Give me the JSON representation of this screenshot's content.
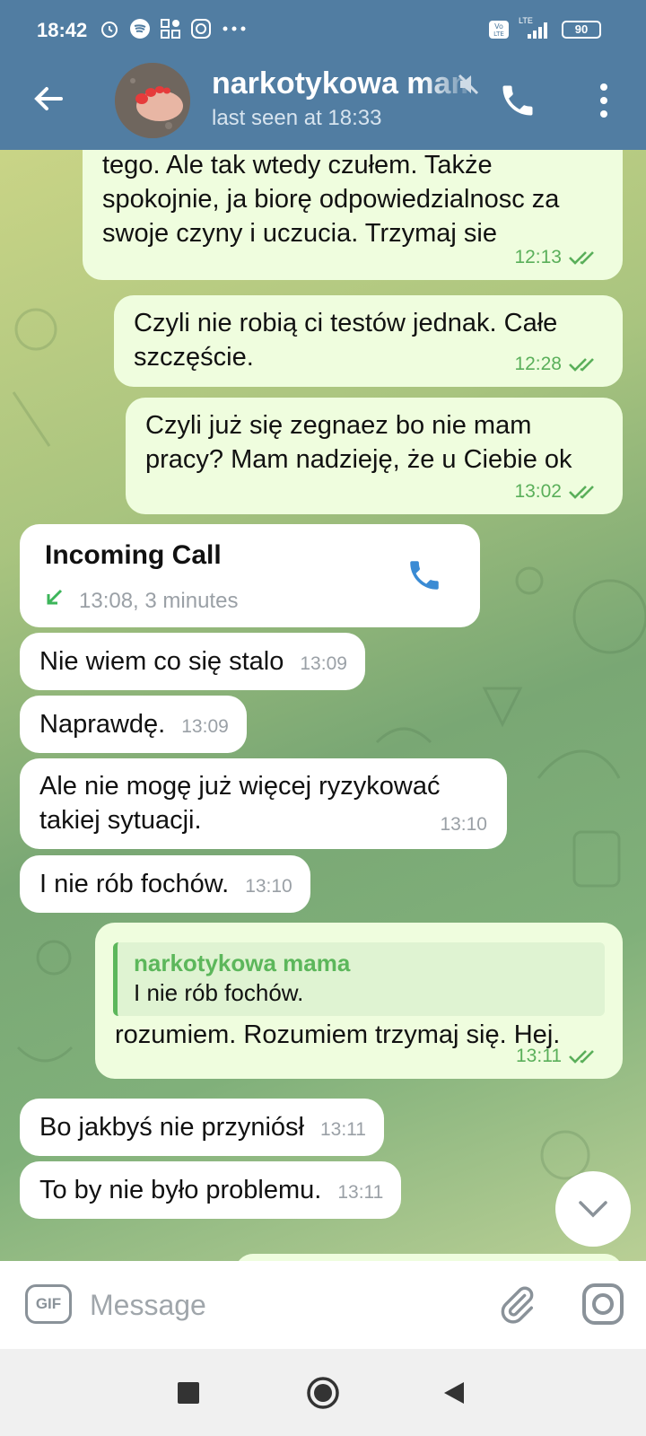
{
  "status_bar": {
    "time": "18:42",
    "battery": "90",
    "network_label": "LTE"
  },
  "header": {
    "title": "narkotykowa mama",
    "subtitle": "last seen at 18:33"
  },
  "messages": [
    {
      "type": "out",
      "text": "tego. Ale tak wtedy czułem. Także spokojnie, ja biorę odpowiedzialnosc za swoje czyny i uczucia. Trzymaj sie",
      "time": "12:13"
    },
    {
      "type": "out",
      "text": "Czyli nie robią ci testów jednak. Całe szczęście.",
      "time": "12:28"
    },
    {
      "type": "out",
      "text": "Czyli już się zegnaez bo nie mam pracy? Mam nadzieję, że u Ciebie ok",
      "time": "13:02"
    },
    {
      "type": "call",
      "title": "Incoming Call",
      "detail": "13:08, 3 minutes"
    },
    {
      "type": "in",
      "text": "Nie wiem co się stalo",
      "time": "13:09"
    },
    {
      "type": "in",
      "text": "Naprawdę.",
      "time": "13:09"
    },
    {
      "type": "in",
      "text": "Ale nie mogę już więcej ryzykować takiej sytuacji.",
      "time": "13:10"
    },
    {
      "type": "in",
      "text": "I nie rób fochów.",
      "time": "13:10"
    },
    {
      "type": "out_reply",
      "reply_name": "narkotykowa mama",
      "reply_text": "I nie rób fochów.",
      "text": "rozumiem. Rozumiem trzymaj się. Hej.",
      "time": "13:11"
    },
    {
      "type": "in",
      "text": "Bo jakbyś nie przyniósł",
      "time": "13:11"
    },
    {
      "type": "in",
      "text": "To by nie było problemu.",
      "time": "13:11"
    }
  ],
  "composer": {
    "gif_label": "GIF",
    "placeholder": "Message"
  },
  "colors": {
    "header": "#517da2",
    "outgoing_bubble": "#effdde",
    "incoming_bubble": "#ffffff",
    "check_green": "#5aaf5a"
  }
}
